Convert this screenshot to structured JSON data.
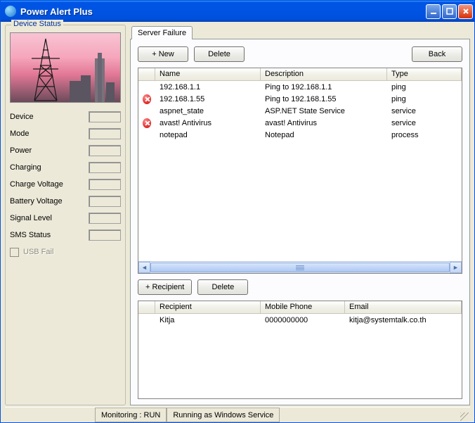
{
  "window": {
    "title": "Power Alert Plus",
    "minimize_tip": "Minimize",
    "maximize_tip": "Maximize",
    "close_tip": "Close"
  },
  "device_status": {
    "legend": "Device Status",
    "rows": [
      {
        "label": "Device",
        "value": ""
      },
      {
        "label": "Mode",
        "value": ""
      },
      {
        "label": "Power",
        "value": ""
      },
      {
        "label": "Charging",
        "value": ""
      },
      {
        "label": "Charge Voltage",
        "value": ""
      },
      {
        "label": "Battery Voltage",
        "value": ""
      },
      {
        "label": "Signal Level",
        "value": ""
      },
      {
        "label": "SMS Status",
        "value": ""
      }
    ],
    "usb_fail_label": "USB Fail"
  },
  "tab": {
    "server_failure": "Server Failure"
  },
  "buttons": {
    "new": "+ New",
    "delete": "Delete",
    "back": "Back",
    "add_recipient": "+ Recipient",
    "delete2": "Delete"
  },
  "grid1": {
    "headers": {
      "icon": "",
      "name": "Name",
      "desc": "Description",
      "type": "Type"
    },
    "rows": [
      {
        "err": false,
        "name": "192.168.1.1",
        "desc": "Ping to 192.168.1.1",
        "type": "ping"
      },
      {
        "err": true,
        "name": "192.168.1.55",
        "desc": "Ping to 192.168.1.55",
        "type": "ping"
      },
      {
        "err": false,
        "name": "aspnet_state",
        "desc": "ASP.NET State Service",
        "type": "service"
      },
      {
        "err": true,
        "name": "avast! Antivirus",
        "desc": "avast! Antivirus",
        "type": "service"
      },
      {
        "err": false,
        "name": "notepad",
        "desc": "Notepad",
        "type": "process"
      }
    ]
  },
  "grid2": {
    "headers": {
      "icon": "",
      "recipient": "Recipient",
      "phone": "Mobile Phone",
      "email": "Email"
    },
    "rows": [
      {
        "recipient": "Kitja",
        "phone": "0000000000",
        "email": "kitja@systemtalk.co.th"
      }
    ]
  },
  "statusbar": {
    "monitoring": "Monitoring : RUN",
    "service": "Running as Windows Service"
  }
}
